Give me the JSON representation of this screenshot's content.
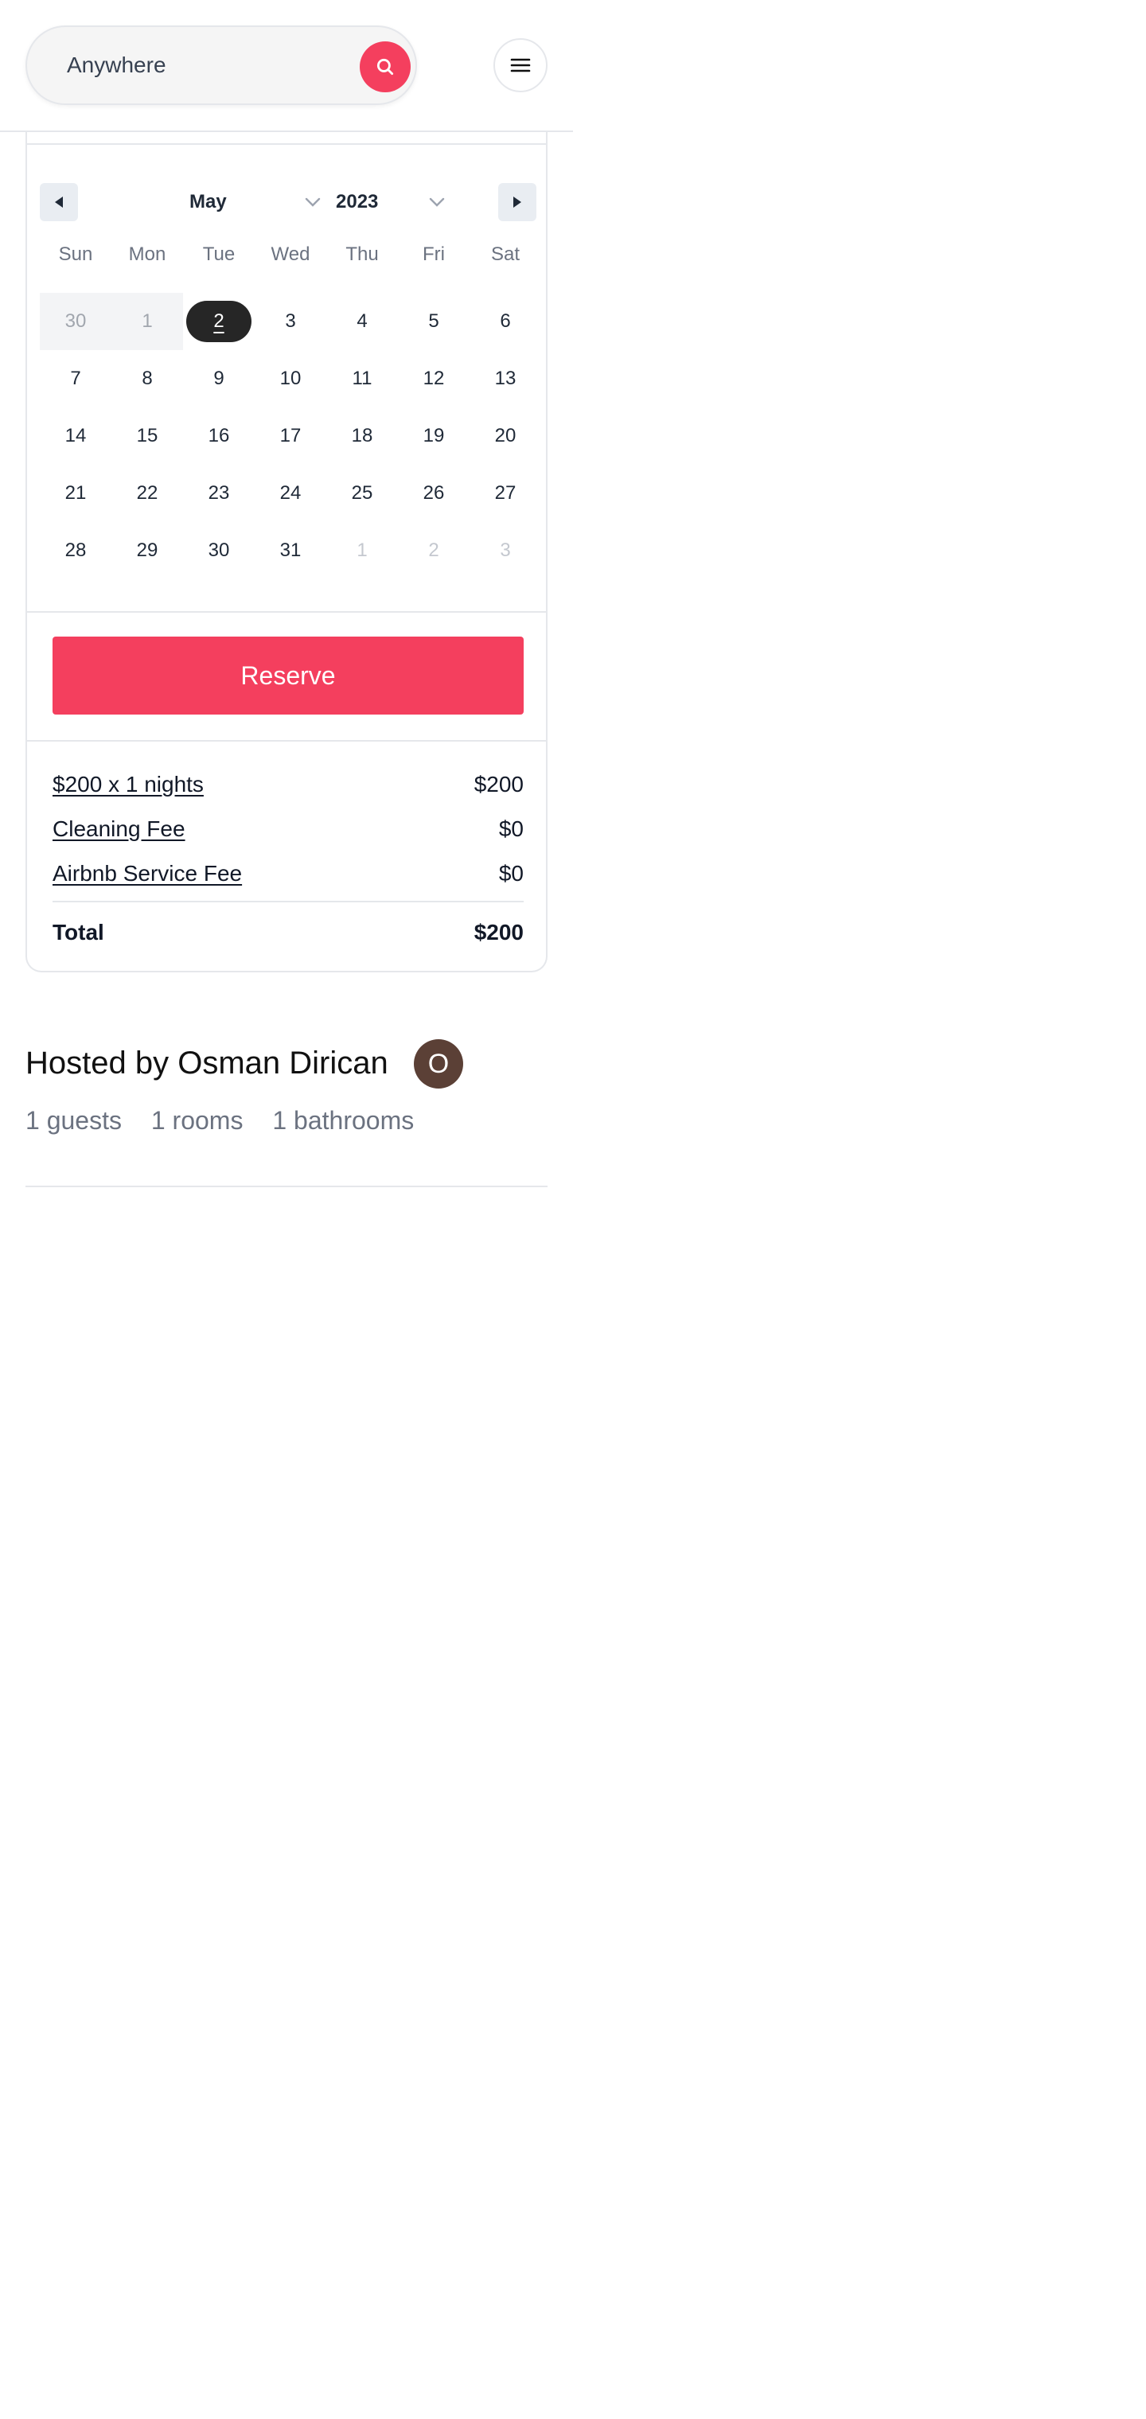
{
  "header": {
    "search_label": "Anywhere",
    "search_icon": "search-icon",
    "menu_icon": "hamburger-menu-icon"
  },
  "calendar": {
    "prev_icon": "triangle-left-icon",
    "next_icon": "triangle-right-icon",
    "month": "May",
    "year": "2023",
    "weekdays": [
      "Sun",
      "Mon",
      "Tue",
      "Wed",
      "Thu",
      "Fri",
      "Sat"
    ],
    "days": [
      [
        "30",
        "1",
        "2",
        "3",
        "4",
        "5",
        "6"
      ],
      [
        "7",
        "8",
        "9",
        "10",
        "11",
        "12",
        "13"
      ],
      [
        "14",
        "15",
        "16",
        "17",
        "18",
        "19",
        "20"
      ],
      [
        "21",
        "22",
        "23",
        "24",
        "25",
        "26",
        "27"
      ],
      [
        "28",
        "29",
        "30",
        "31",
        "1",
        "2",
        "3"
      ]
    ],
    "selected_day": "2"
  },
  "booking": {
    "reserve_label": "Reserve",
    "lines": [
      {
        "label": "$200 x 1 nights",
        "value": "$200"
      },
      {
        "label": "Cleaning Fee",
        "value": "$0"
      },
      {
        "label": "Airbnb Service Fee",
        "value": "$0"
      }
    ],
    "total_label": "Total",
    "total_value": "$200"
  },
  "host": {
    "title": "Hosted by Osman Dirican",
    "avatar_initial": "O",
    "guests": "1 guests",
    "rooms": "1 rooms",
    "bathrooms": "1 bathrooms"
  },
  "colors": {
    "accent": "#f43f5e",
    "selected_day_bg": "#262626",
    "avatar_bg": "#5b4036"
  }
}
